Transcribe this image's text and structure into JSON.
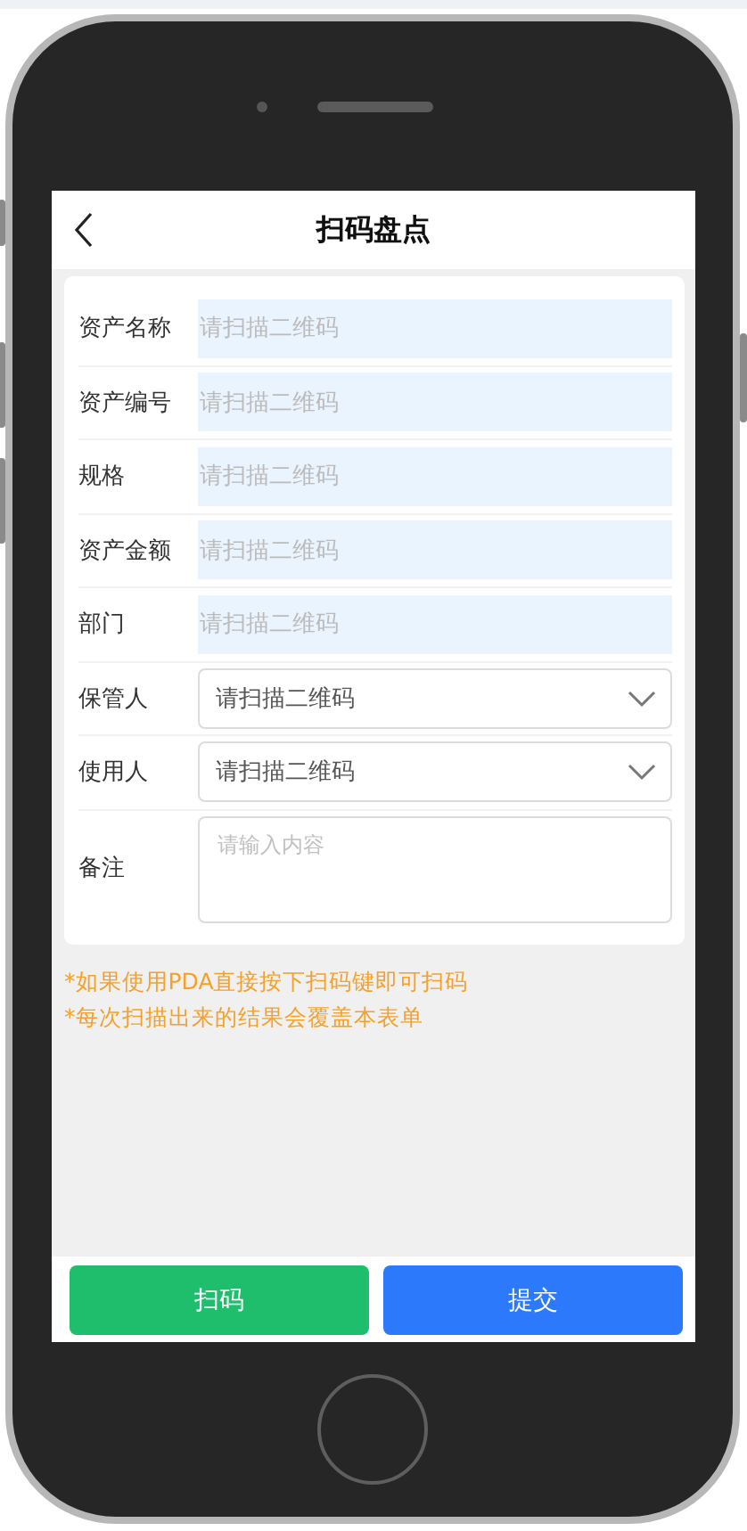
{
  "header": {
    "title": "扫码盘点"
  },
  "fields": [
    {
      "kind": "scan",
      "label": "资产名称",
      "placeholder": "请扫描二维码"
    },
    {
      "kind": "scan",
      "label": "资产编号",
      "placeholder": "请扫描二维码"
    },
    {
      "kind": "scan",
      "label": "规格",
      "placeholder": "请扫描二维码"
    },
    {
      "kind": "scan",
      "label": "资产金额",
      "placeholder": "请扫描二维码"
    },
    {
      "kind": "scan",
      "label": "部门",
      "placeholder": "请扫描二维码"
    },
    {
      "kind": "select",
      "label": "保管人",
      "placeholder": "请扫描二维码"
    },
    {
      "kind": "select",
      "label": "使用人",
      "placeholder": "请扫描二维码"
    },
    {
      "kind": "textarea",
      "label": "备注",
      "placeholder": "请输入内容"
    }
  ],
  "notes": [
    "*如果使用PDA直接按下扫码键即可扫码",
    "*每次扫描出来的结果会覆盖本表单"
  ],
  "buttons": [
    {
      "kind": "scan",
      "label": "扫码"
    },
    {
      "kind": "submit",
      "label": "提交"
    }
  ]
}
